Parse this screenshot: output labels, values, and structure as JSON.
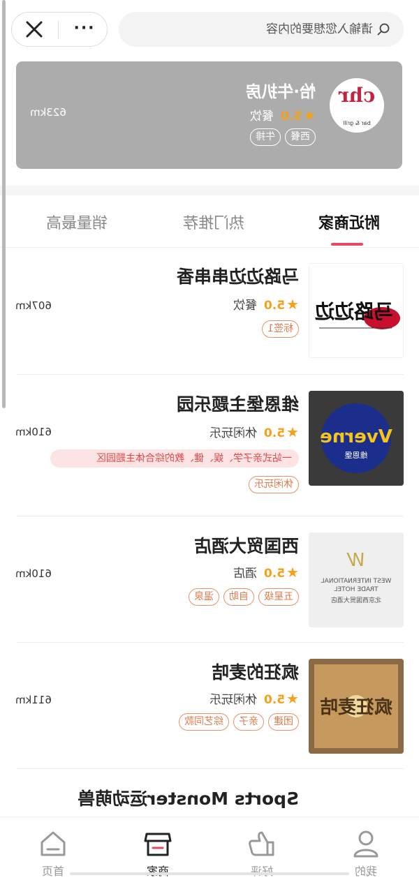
{
  "header": {
    "search_placeholder": "请输入您想要的内容",
    "more_label": "···"
  },
  "featured": {
    "logo_text": "chr",
    "logo_sub": "bar & grill",
    "name": "怡·牛扒房",
    "star": "★",
    "rating": "5.0",
    "category": "餐饮",
    "tags": [
      "西餐",
      "牛排"
    ],
    "distance": "623km"
  },
  "tabs": [
    {
      "label": "附近商家",
      "active": true
    },
    {
      "label": "热门推荐",
      "active": false
    },
    {
      "label": "销量最高",
      "active": false
    }
  ],
  "items": [
    {
      "name": "马路边边串串香",
      "star": "★",
      "rating": "5.0",
      "category": "餐饮",
      "distance": "607km",
      "tags": [
        "标签1"
      ],
      "thumb_text": "马路边边"
    },
    {
      "name": "维恩堡主题乐园",
      "star": "★",
      "rating": "5.0",
      "category": "休闲玩乐",
      "distance": "610km",
      "promo": "一站式亲子学、娱、健、教的综合体主题园区",
      "tags": [
        "休闲玩乐"
      ],
      "thumb_text": "Vverne",
      "thumb_sub": "维恩堡"
    },
    {
      "name": "西国贸大酒店",
      "star": "★",
      "rating": "5.0",
      "category": "酒店",
      "distance": "610km",
      "tags": [
        "五星级",
        "自助",
        "温泉"
      ],
      "thumb_lines": [
        "WEST INTERNATIONAL",
        "TRADE HOTEL",
        "北京西国贸大酒店"
      ]
    },
    {
      "name": "疯狂的麦咭",
      "star": "★",
      "rating": "5.0",
      "category": "休闲玩乐",
      "distance": "611km",
      "tags": [
        "团建",
        "亲子",
        "综艺同款"
      ],
      "thumb_text": "疯狂麦咭"
    },
    {
      "name": "Sports Monster运动萌兽"
    }
  ],
  "nav": [
    {
      "label": "首页",
      "icon": "home-icon"
    },
    {
      "label": "商家",
      "icon": "store-icon",
      "active": true
    },
    {
      "label": "好评",
      "icon": "thumbs-up-icon"
    },
    {
      "label": "我的",
      "icon": "user-icon"
    }
  ],
  "colors": {
    "accent": "#e84864",
    "star": "#f4a01a",
    "tag": "#e07a4d",
    "featured_bg": "#acacac"
  }
}
